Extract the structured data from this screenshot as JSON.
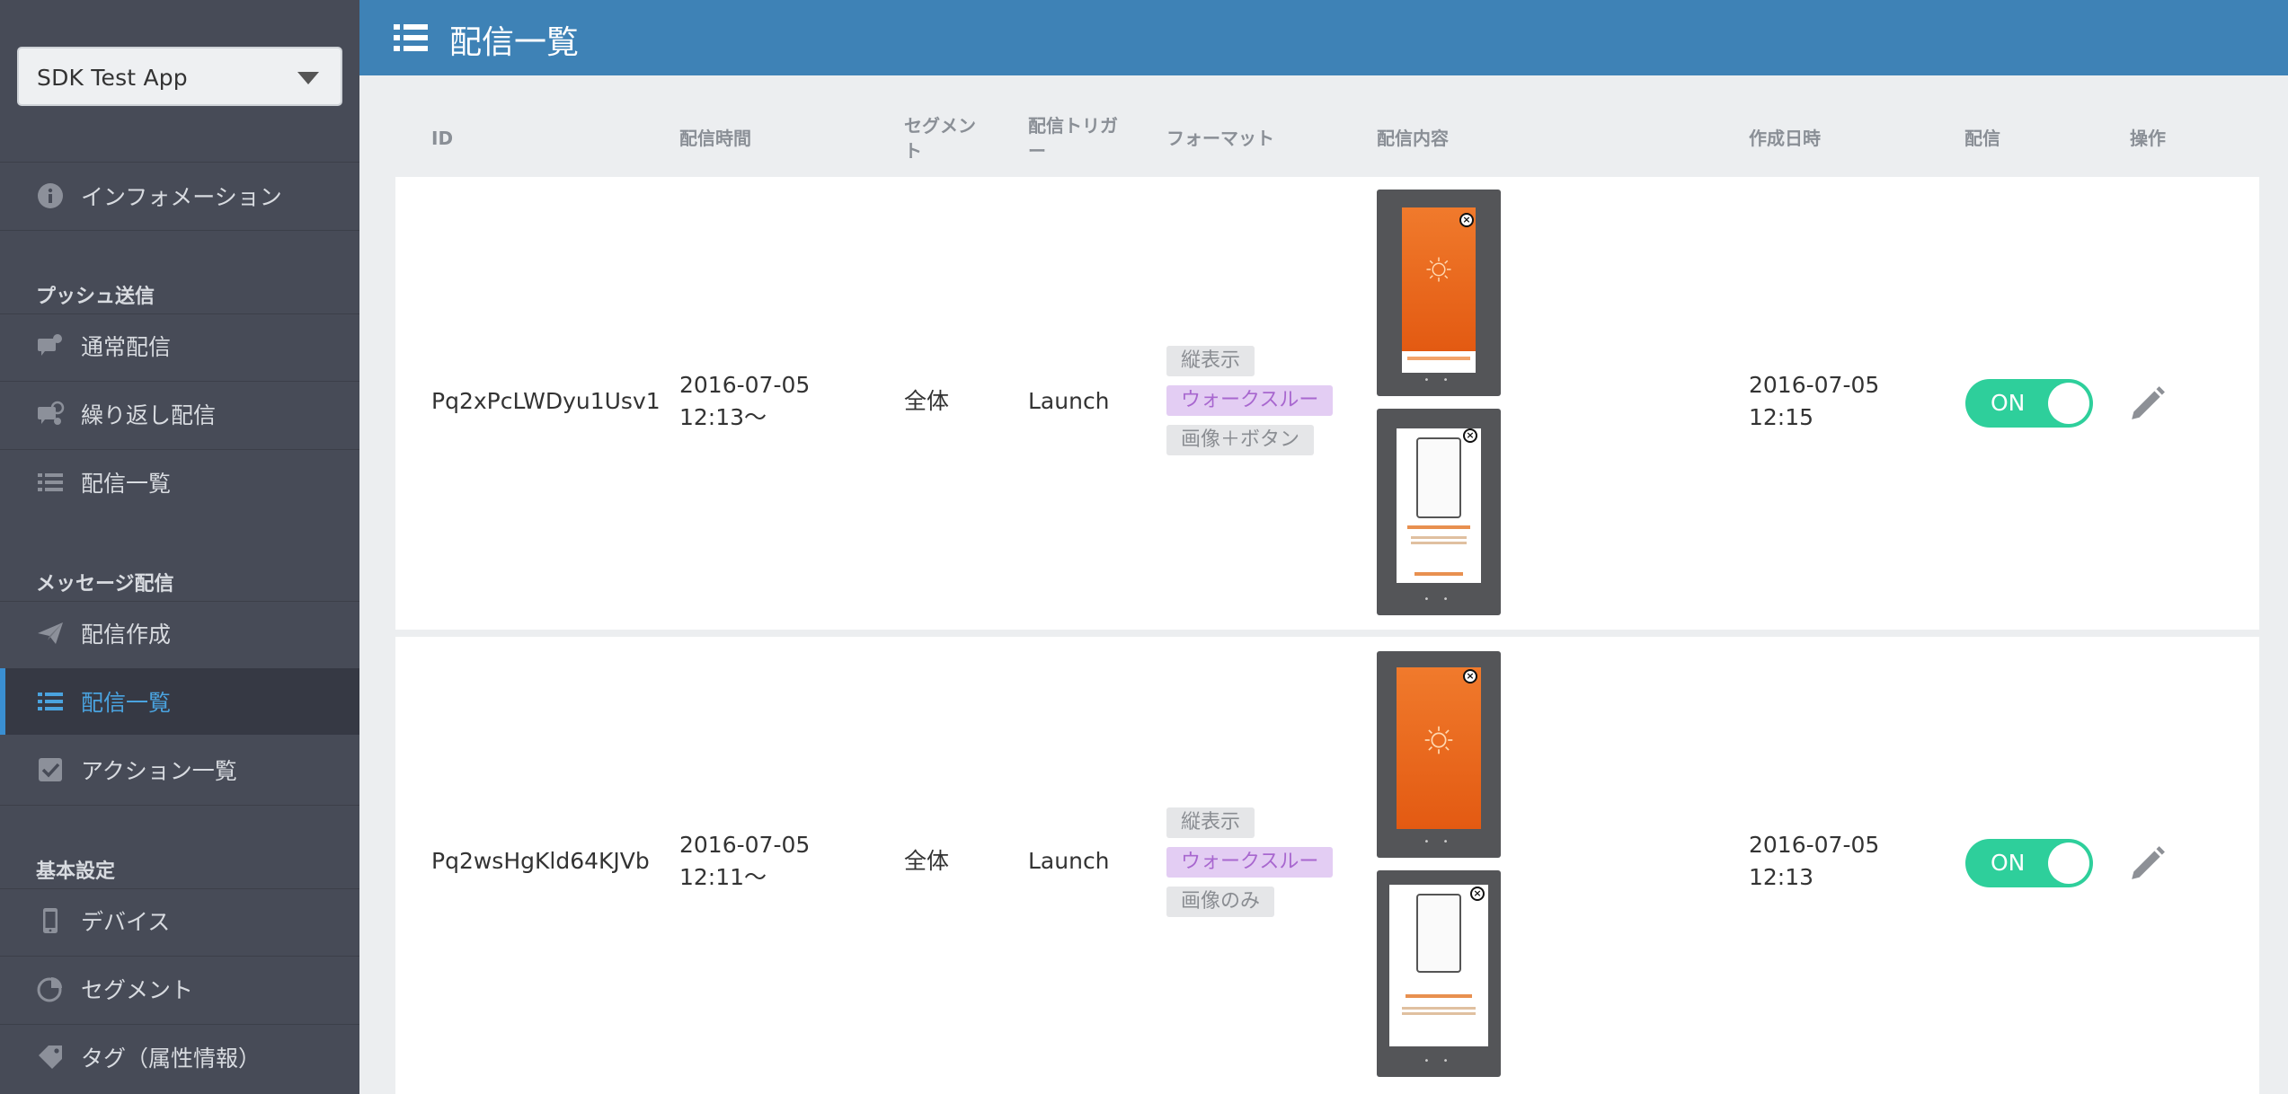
{
  "app_select": {
    "label": "SDK Test App"
  },
  "sidebar": {
    "info": "インフォメーション",
    "push_heading": "プッシュ送信",
    "push_normal": "通常配信",
    "push_repeat": "繰り返し配信",
    "push_list": "配信一覧",
    "msg_heading": "メッセージ配信",
    "msg_create": "配信作成",
    "msg_list": "配信一覧",
    "msg_actions": "アクション一覧",
    "base_heading": "基本設定",
    "devices": "デバイス",
    "segments": "セグメント",
    "tags": "タグ（属性情報）"
  },
  "header": {
    "title": "配信一覧"
  },
  "table": {
    "headers": {
      "id": "ID",
      "time": "配信時間",
      "segment_1": "セグメン",
      "segment_2": "ト",
      "trigger_1": "配信トリガ",
      "trigger_2": "ー",
      "format": "フォーマット",
      "content": "配信内容",
      "created": "作成日時",
      "delivery": "配信",
      "ops": "操作"
    },
    "rows": [
      {
        "id": "Pq2xPcLWDyu1Usv1",
        "time_date": "2016-07-05",
        "time_clock": "12:13〜",
        "segment": "全体",
        "trigger": "Launch",
        "tags": [
          "縦表示",
          "ウォークスルー",
          "画像＋ボタン"
        ],
        "created_date": "2016-07-05",
        "created_clock": "12:15",
        "toggle": "ON"
      },
      {
        "id": "Pq2wsHgKld64KJVb",
        "time_date": "2016-07-05",
        "time_clock": "12:11〜",
        "segment": "全体",
        "trigger": "Launch",
        "tags": [
          "縦表示",
          "ウォークスルー",
          "画像のみ"
        ],
        "created_date": "2016-07-05",
        "created_clock": "12:13",
        "toggle": "ON"
      }
    ]
  },
  "icons": {
    "info": "info-circle-icon",
    "push_normal": "chat-bubble-icon",
    "push_repeat": "repeat-chat-icon",
    "list": "list-icon",
    "send": "paper-plane-icon",
    "check": "checkbox-icon",
    "device": "mobile-device-icon",
    "pie": "pie-chart-icon",
    "tag": "tag-icon",
    "edit": "pencil-icon"
  },
  "colors": {
    "sidebar_bg": "#474b57",
    "header_bg": "#3e82b6",
    "active_text": "#4aa3df",
    "toggle_on": "#2ecf9b",
    "tag_purple_bg": "#e3cdf3",
    "tag_purple_text": "#a867cf"
  }
}
